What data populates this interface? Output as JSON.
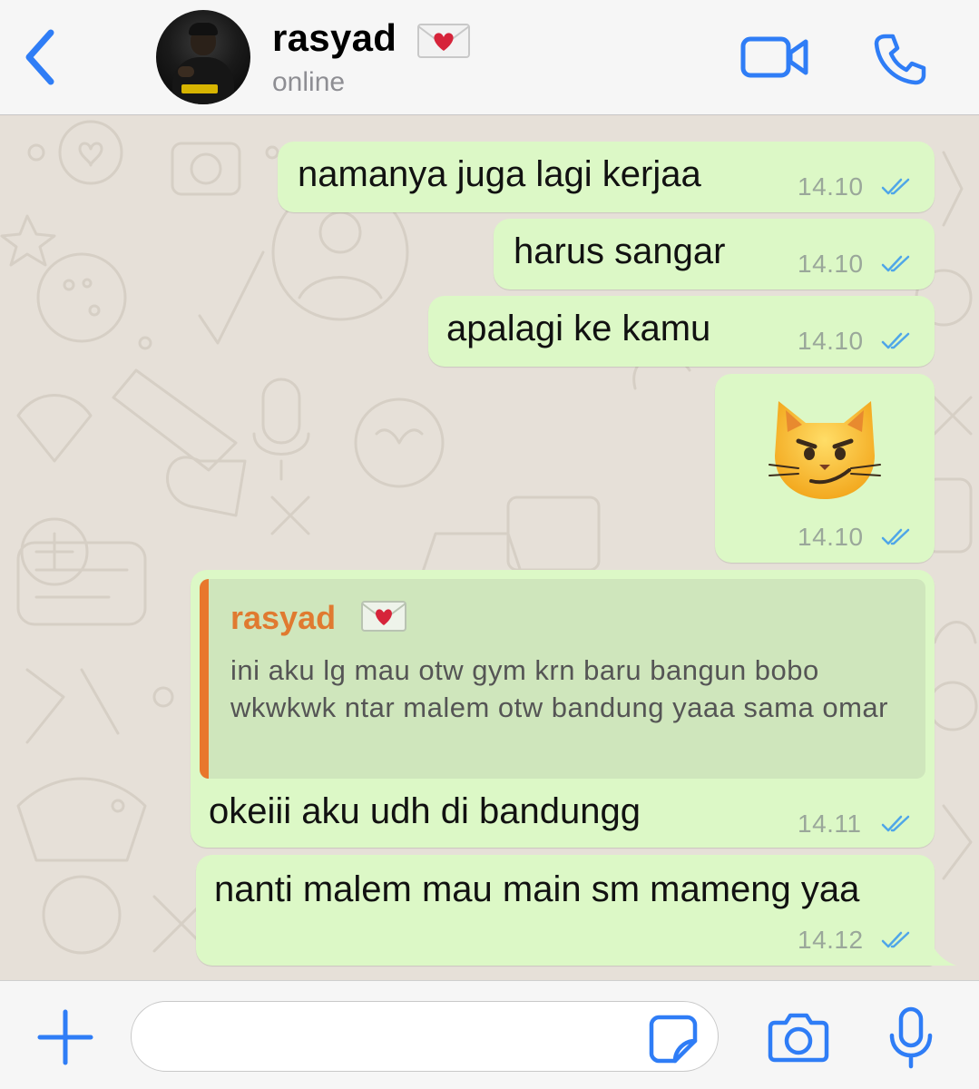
{
  "header": {
    "back_icon": "chevron-left-icon",
    "contact_name": "rasyad",
    "name_emoji": "love-letter-emoji",
    "status": "online",
    "video_icon": "video-camera-icon",
    "call_icon": "phone-icon"
  },
  "messages": [
    {
      "text": "namanya juga lagi kerjaa",
      "time": "14.10",
      "status": "read"
    },
    {
      "text": "harus sangar",
      "time": "14.10",
      "status": "read"
    },
    {
      "text": "apalagi ke kamu",
      "time": "14.10",
      "status": "read"
    },
    {
      "emoji": "smirking-cat-emoji",
      "time": "14.10",
      "status": "read"
    },
    {
      "reply": {
        "name": "rasyad",
        "name_emoji": "love-letter-emoji",
        "text": "ini aku lg mau otw gym krn baru bangun bobo wkwkwk ntar malem otw bandung yaaa sama omar"
      },
      "text": "okeiii aku udh di bandungg",
      "time": "14.11",
      "status": "read"
    },
    {
      "text": "nanti malem mau main sm mameng yaa",
      "time": "14.12",
      "status": "read"
    }
  ],
  "composer": {
    "plus_icon": "plus-icon",
    "placeholder": "",
    "sticker_icon": "sticker-icon",
    "camera_icon": "camera-icon",
    "mic_icon": "microphone-icon"
  },
  "colors": {
    "accent": "#2f7df6",
    "outgoing_bubble": "#dcf8c6",
    "quote_bar": "#e8772c",
    "read_tick": "#4fa6e8"
  }
}
